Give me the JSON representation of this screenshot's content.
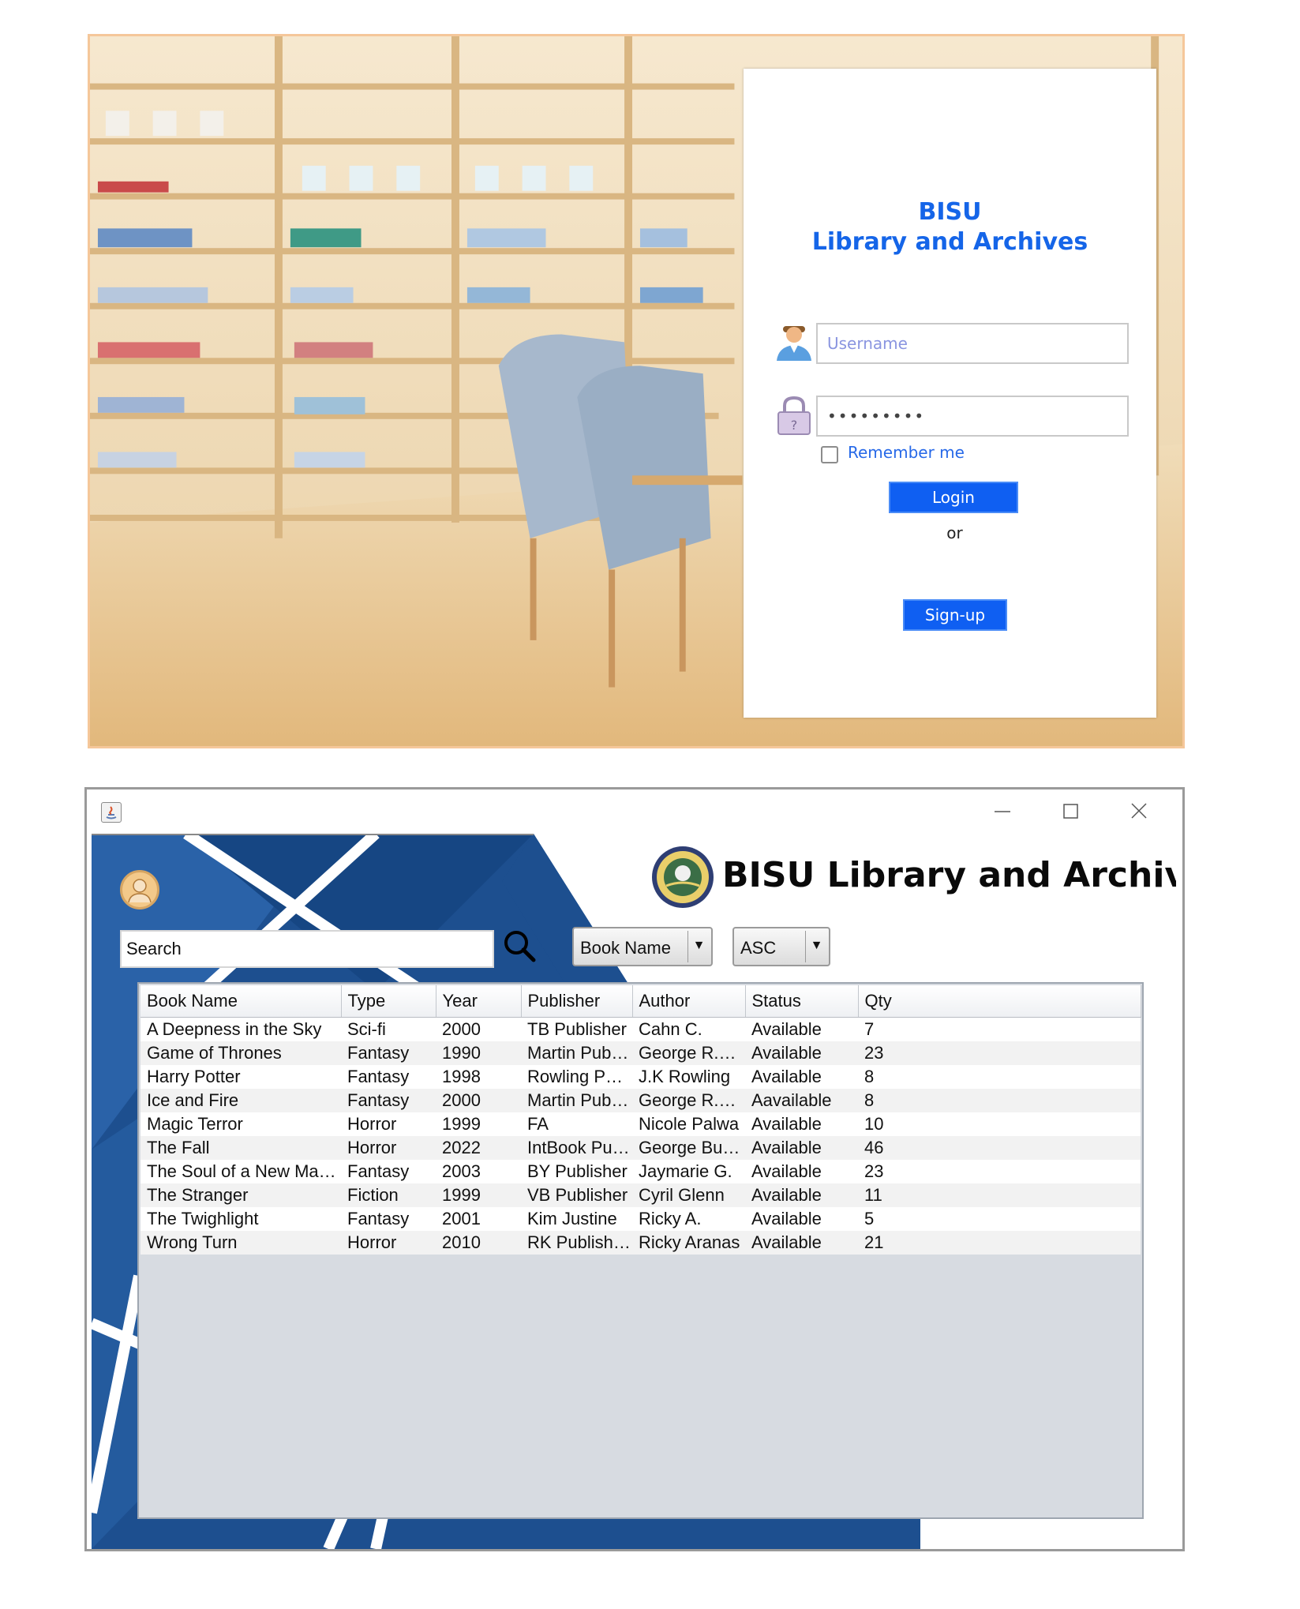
{
  "login": {
    "title_line1": "BISU",
    "title_line2": "Library and Archives",
    "username_placeholder": "Username",
    "password_value": "•••••••••",
    "remember_label": "Remember me",
    "login_label": "Login",
    "or_label": "or",
    "signup_label": "Sign-up",
    "accent_color": "#0f5ff2"
  },
  "main": {
    "app_title": "BISU Library and Archives",
    "search": {
      "value": "Search"
    },
    "sort_column": "Book Name",
    "sort_order": "ASC",
    "table": {
      "columns": [
        "Book Name",
        "Type",
        "Year",
        "Publisher",
        "Author",
        "Status",
        "Qty"
      ],
      "rows": [
        [
          "A Deepness in the Sky",
          "Sci-fi",
          "2000",
          "TB Publisher",
          "Cahn C.",
          "Available",
          "7"
        ],
        [
          "Game of Thrones",
          "Fantasy",
          "1990",
          "Martin Publishin...",
          "George R.R. M...",
          "Available",
          "23"
        ],
        [
          "Harry Potter",
          "Fantasy",
          "1998",
          "Rowling Publis...",
          "J.K Rowling",
          "Available",
          "8"
        ],
        [
          "Ice and Fire",
          "Fantasy",
          "2000",
          "Martin Publishin...",
          "George R.R. M...",
          "Aavailable",
          "8"
        ],
        [
          "Magic Terror",
          "Horror",
          "1999",
          "FA",
          "Nicole Palwa",
          "Available",
          "10"
        ],
        [
          "The Fall",
          "Horror",
          "2022",
          "IntBook Publish...",
          "George Bugwak",
          "Available",
          "46"
        ],
        [
          "The Soul of a New Machine",
          "Fantasy",
          "2003",
          "BY Publisher",
          "Jaymarie G.",
          "Available",
          "23"
        ],
        [
          "The Stranger",
          "Fiction",
          "1999",
          "VB Publisher",
          "Cyril Glenn",
          "Available",
          "11"
        ],
        [
          "The Twighlight",
          "Fantasy",
          "2001",
          "Kim Justine",
          "Ricky A.",
          "Available",
          "5"
        ],
        [
          "Wrong Turn",
          "Horror",
          "2010",
          "RK Publishing",
          "Ricky Aranas",
          "Available",
          "21"
        ]
      ]
    }
  },
  "icons": {
    "user": "user-icon",
    "lock": "lock-icon",
    "search": "search-icon",
    "java": "java-icon",
    "seal": "university-seal-icon",
    "avatar": "avatar-icon"
  }
}
